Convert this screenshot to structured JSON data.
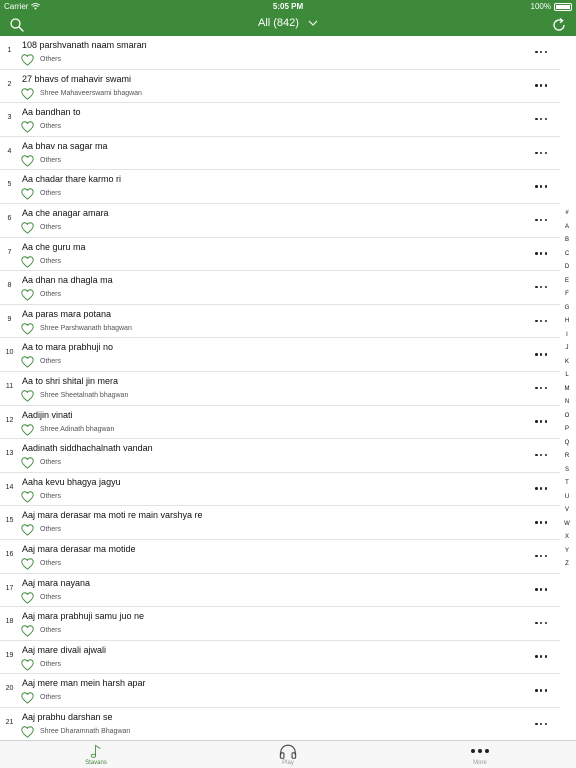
{
  "status_bar": {
    "carrier": "Carrier",
    "time": "5:05 PM",
    "battery": "100%"
  },
  "nav": {
    "title": "All (842)",
    "left_icon": "search-icon",
    "right_icon": "refresh-icon"
  },
  "colors": {
    "brand": "#3c8a3a",
    "heart": "#3c8a3a"
  },
  "items": [
    {
      "num": "1",
      "title": "108 parshvanath naam smaran",
      "category": "Others"
    },
    {
      "num": "2",
      "title": "27 bhavs of mahavir swami",
      "category": "Shree Mahaveerswami bhagwan"
    },
    {
      "num": "3",
      "title": "Aa bandhan to",
      "category": "Others"
    },
    {
      "num": "4",
      "title": "Aa bhav na sagar ma",
      "category": "Others"
    },
    {
      "num": "5",
      "title": "Aa chadar thare karmo ri",
      "category": "Others"
    },
    {
      "num": "6",
      "title": "Aa che anagar amara",
      "category": "Others"
    },
    {
      "num": "7",
      "title": "Aa che guru ma",
      "category": "Others"
    },
    {
      "num": "8",
      "title": "Aa dhan na dhagla ma",
      "category": "Others"
    },
    {
      "num": "9",
      "title": "Aa paras mara potana",
      "category": "Shree Parshwanath bhagwan"
    },
    {
      "num": "10",
      "title": "Aa to mara prabhuji no",
      "category": "Others"
    },
    {
      "num": "11",
      "title": "Aa to shri shital jin mera",
      "category": "Shree Sheetalnath bhagwan"
    },
    {
      "num": "12",
      "title": "Aadijin vinati",
      "category": "Shree Adinath bhagwan"
    },
    {
      "num": "13",
      "title": "Aadinath siddhachalnath vandan",
      "category": "Others"
    },
    {
      "num": "14",
      "title": "Aaha kevu bhagya jagyu",
      "category": "Others"
    },
    {
      "num": "15",
      "title": "Aaj mara derasar ma moti re main varshya re",
      "category": "Others"
    },
    {
      "num": "16",
      "title": "Aaj mara derasar ma motide",
      "category": "Others"
    },
    {
      "num": "17",
      "title": "Aaj mara nayana",
      "category": "Others"
    },
    {
      "num": "18",
      "title": "Aaj mara prabhuji samu juo ne",
      "category": "Others"
    },
    {
      "num": "19",
      "title": "Aaj mare divali ajwali",
      "category": "Others"
    },
    {
      "num": "20",
      "title": "Aaj mere man mein harsh apar",
      "category": "Others"
    },
    {
      "num": "21",
      "title": "Aaj prabhu darshan se",
      "category": "Shree Dharamnath Bhagwan"
    }
  ],
  "index_letters": [
    "#",
    "A",
    "B",
    "C",
    "D",
    "E",
    "F",
    "G",
    "H",
    "I",
    "J",
    "K",
    "L",
    "M",
    "N",
    "O",
    "P",
    "Q",
    "R",
    "S",
    "T",
    "U",
    "V",
    "W",
    "X",
    "Y",
    "Z"
  ],
  "tabs": [
    {
      "label": "Stavans",
      "icon": "music-note-icon",
      "active": true
    },
    {
      "label": "Play",
      "icon": "headphones-icon",
      "active": false
    },
    {
      "label": "More",
      "icon": "more-dots-icon",
      "active": false
    }
  ]
}
